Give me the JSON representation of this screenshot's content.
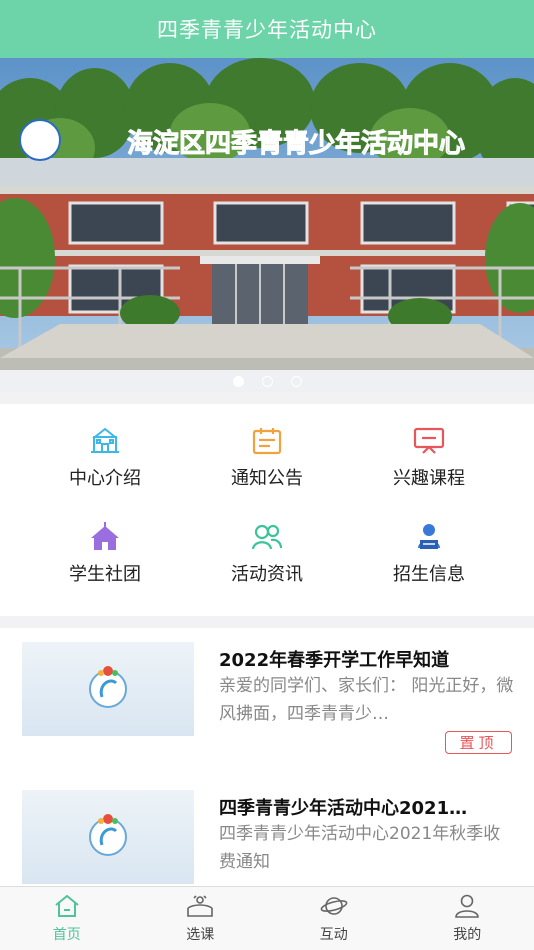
{
  "header": {
    "title": "四季青青少年活动中心"
  },
  "banner": {
    "sign_text": "海淀区四季青青少年活动中心",
    "dots": [
      true,
      false,
      false
    ]
  },
  "menu": {
    "items": [
      {
        "label": "中心介绍",
        "icon": "school-building-icon",
        "color": "#3bb8e8"
      },
      {
        "label": "通知公告",
        "icon": "notice-board-icon",
        "color": "#f0a23c"
      },
      {
        "label": "兴趣课程",
        "icon": "course-screen-icon",
        "color": "#e8565b"
      },
      {
        "label": "学生社团",
        "icon": "club-tent-icon",
        "color": "#9b6ee0"
      },
      {
        "label": "活动资讯",
        "icon": "people-icon",
        "color": "#3cc39a"
      },
      {
        "label": "招生信息",
        "icon": "enrollment-icon",
        "color": "#3a78d8"
      }
    ]
  },
  "news": {
    "items": [
      {
        "title": "2022年春季开学工作早知道",
        "desc": "亲爱的同学们、家长们： 阳光正好，微风拂面，四季青青少…",
        "badge": "置顶"
      },
      {
        "title": "四季青青少年活动中心2021…",
        "desc": "四季青青少年活动中心2021年秋季收费通知",
        "badge": ""
      }
    ]
  },
  "tabbar": {
    "tabs": [
      {
        "label": "首页",
        "icon": "home-icon",
        "active": true
      },
      {
        "label": "选课",
        "icon": "course-select-icon",
        "active": false
      },
      {
        "label": "互动",
        "icon": "planet-icon",
        "active": false
      },
      {
        "label": "我的",
        "icon": "user-icon",
        "active": false
      }
    ]
  },
  "colors": {
    "header": "#6dd3a8",
    "active_tab": "#4fc39a",
    "pin_badge": "#e8565b"
  }
}
